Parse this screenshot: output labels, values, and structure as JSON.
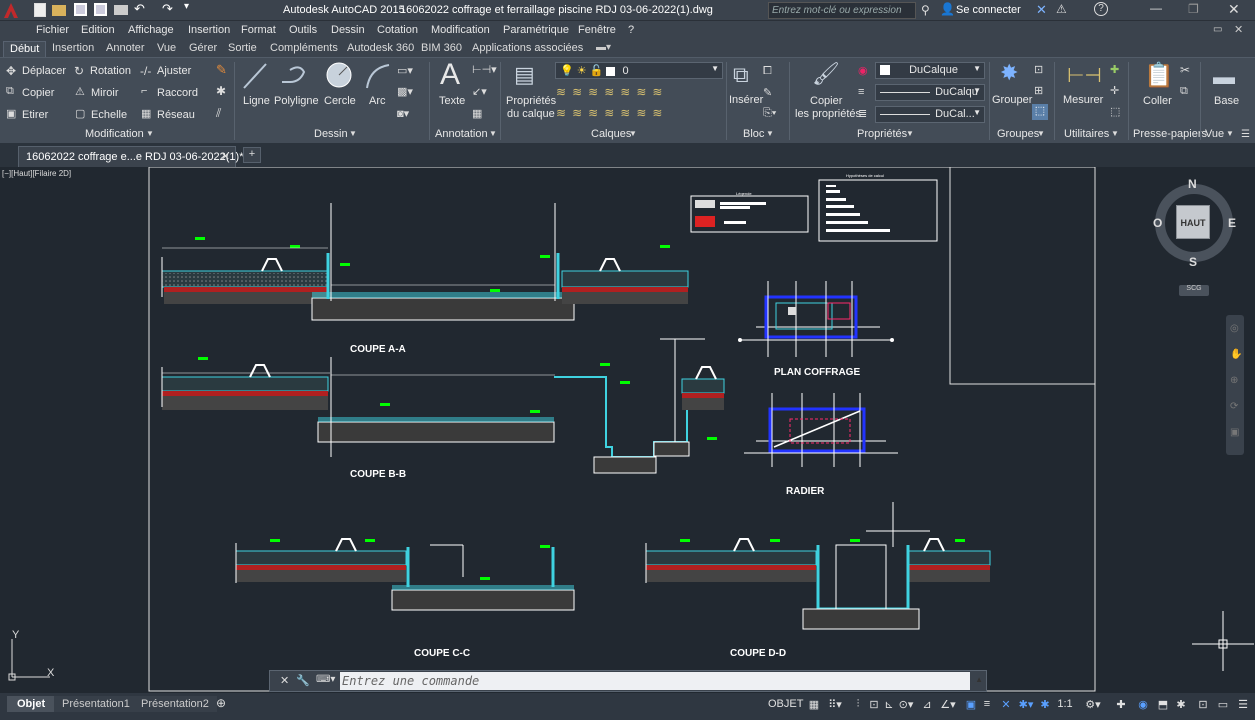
{
  "titlebar": {
    "app_title": "Autodesk AutoCAD 2015",
    "file_title": "16062022 coffrage et ferraillage piscine RDJ 03-06-2022(1).dwg",
    "search_placeholder": "Entrez mot-clé ou expression",
    "signin": "Se connecter"
  },
  "menu": [
    "Fichier",
    "Edition",
    "Affichage",
    "Insertion",
    "Format",
    "Outils",
    "Dessin",
    "Cotation",
    "Modification",
    "Paramétrique",
    "Fenêtre",
    "?"
  ],
  "ribbon_tabs": [
    "Début",
    "Insertion",
    "Annoter",
    "Vue",
    "Gérer",
    "Sortie",
    "Compléments",
    "Autodesk 360",
    "BIM 360",
    "Applications associées"
  ],
  "ribbon": {
    "modification": {
      "title": "Modification",
      "deplacer": "Déplacer",
      "rotation": "Rotation",
      "ajuster": "Ajuster",
      "copier": "Copier",
      "miroir": "Miroir",
      "raccord": "Raccord",
      "etirer": "Etirer",
      "echelle": "Echelle",
      "reseau": "Réseau"
    },
    "dessin": {
      "title": "Dessin",
      "ligne": "Ligne",
      "polyligne": "Polyligne",
      "cercle": "Cercle",
      "arc": "Arc"
    },
    "annotation": {
      "title": "Annotation",
      "texte": "Texte"
    },
    "calques": {
      "title": "Calques",
      "props_line1": "Propriétés",
      "props_line2": "du calque",
      "current_layer": "0"
    },
    "bloc": {
      "title": "Bloc",
      "inserer": "Insérer"
    },
    "proprietes": {
      "title": "Propriétés",
      "copier_line1": "Copier",
      "copier_line2": "les propriétés",
      "color": "DuCalque",
      "linetype": "DuCalqu",
      "lineweight": "DuCal..."
    },
    "groupes": {
      "title": "Groupes",
      "grouper": "Grouper"
    },
    "utilitaires": {
      "title": "Utilitaires",
      "mesurer": "Mesurer"
    },
    "presse_papiers": {
      "title": "Presse-papiers",
      "coller": "Coller"
    },
    "vue": {
      "title": "Vue",
      "base": "Base"
    }
  },
  "doc_tab": "16062022 coffrage e...e RDJ 03-06-2022(1)*",
  "viewport_label": "[−][Haut][Filaire 2D]",
  "viewcube": {
    "north": "N",
    "south": "S",
    "east": "E",
    "west": "O",
    "face": "HAUT",
    "ucs": "SCG"
  },
  "drawing_labels": {
    "coupe_aa": "COUPE A-A",
    "coupe_bb": "COUPE B-B",
    "coupe_cc": "COUPE C-C",
    "coupe_dd": "COUPE D-D",
    "plan_coffrage": "PLAN COFFRAGE",
    "radier": "RADIER",
    "legende": "Légende",
    "hypotheses": "Hypothèses de calcul"
  },
  "ucs_icon": {
    "x": "X",
    "y": "Y"
  },
  "command_placeholder": "Entrez une commande",
  "layout_tabs": [
    "Objet",
    "Présentation1",
    "Présentation2"
  ],
  "status": {
    "model": "OBJET",
    "scale": "1:1"
  },
  "colors": {
    "background": "#212830",
    "ribbon": "#434c57",
    "accent_red": "#c0292b",
    "cyan": "#3fd2e0",
    "green": "#00ff00"
  }
}
